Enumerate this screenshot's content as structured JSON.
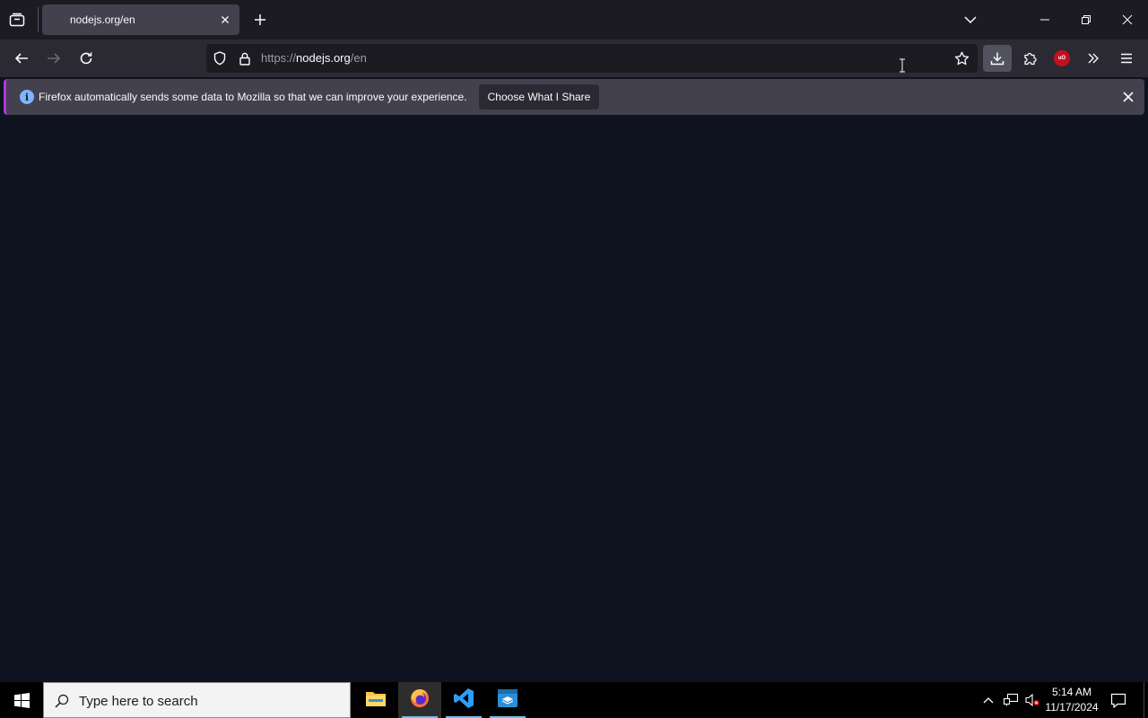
{
  "browser": {
    "tab": {
      "title": "nodejs.org/en"
    },
    "urlbar": {
      "scheme": "https://",
      "host": "nodejs.org",
      "path": "/en"
    },
    "notification": {
      "message": "Firefox automatically sends some data to Mozilla so that we can improve your experience.",
      "button_label": "Choose What I Share"
    },
    "extension_badge": "uO"
  },
  "taskbar": {
    "search_placeholder": "Type here to search",
    "time": "5:14 AM",
    "date": "11/17/2024",
    "apps": [
      "file-explorer",
      "firefox",
      "vscode",
      "sandbox"
    ]
  },
  "colors": {
    "page_bg": "#0f1320",
    "tabstrip_bg": "#1c1b22",
    "toolbar_bg": "#2b2a33",
    "notification_accent": "#b833e1",
    "taskbar_accent": "#76b9ed"
  }
}
